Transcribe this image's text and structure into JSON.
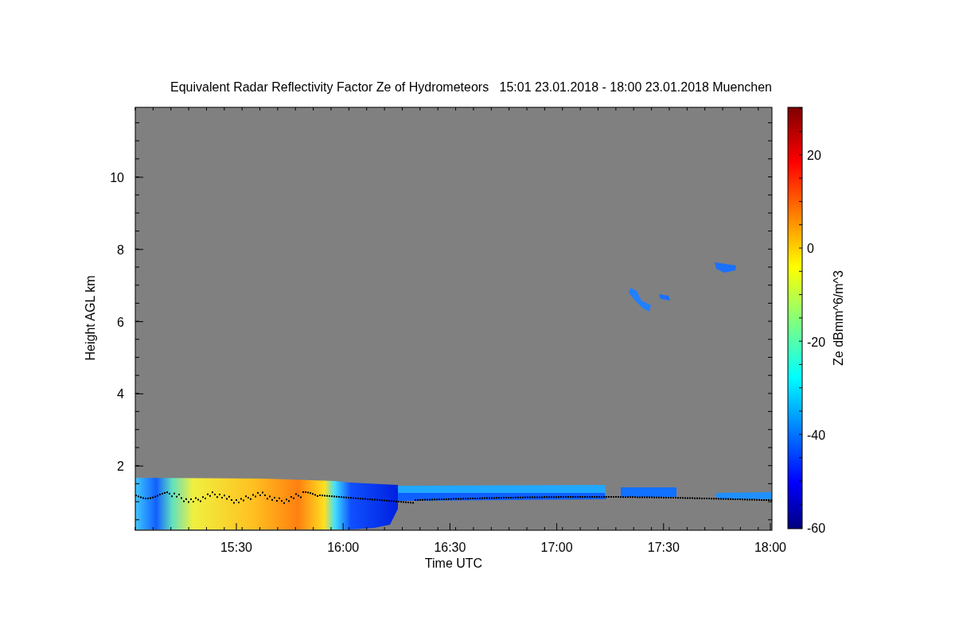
{
  "plot": {
    "title": "Equivalent Radar Reflectivity Factor Ze of Hydrometeors   15:01 23.01.2018 - 18:00 23.01.2018 Muenchen",
    "x_axis": {
      "label": "Time UTC",
      "ticks": [
        "15:30",
        "16:00",
        "16:30",
        "17:00",
        "17:30",
        "18:00"
      ]
    },
    "y_axis": {
      "label": "Height AGL km",
      "ticks": [
        "10",
        "8",
        "6",
        "4",
        "2"
      ]
    },
    "colorbar": {
      "label": "Ze dBmm^6/m^3",
      "ticks": [
        "20",
        "0",
        "-20",
        "-40",
        "-60"
      ]
    }
  }
}
